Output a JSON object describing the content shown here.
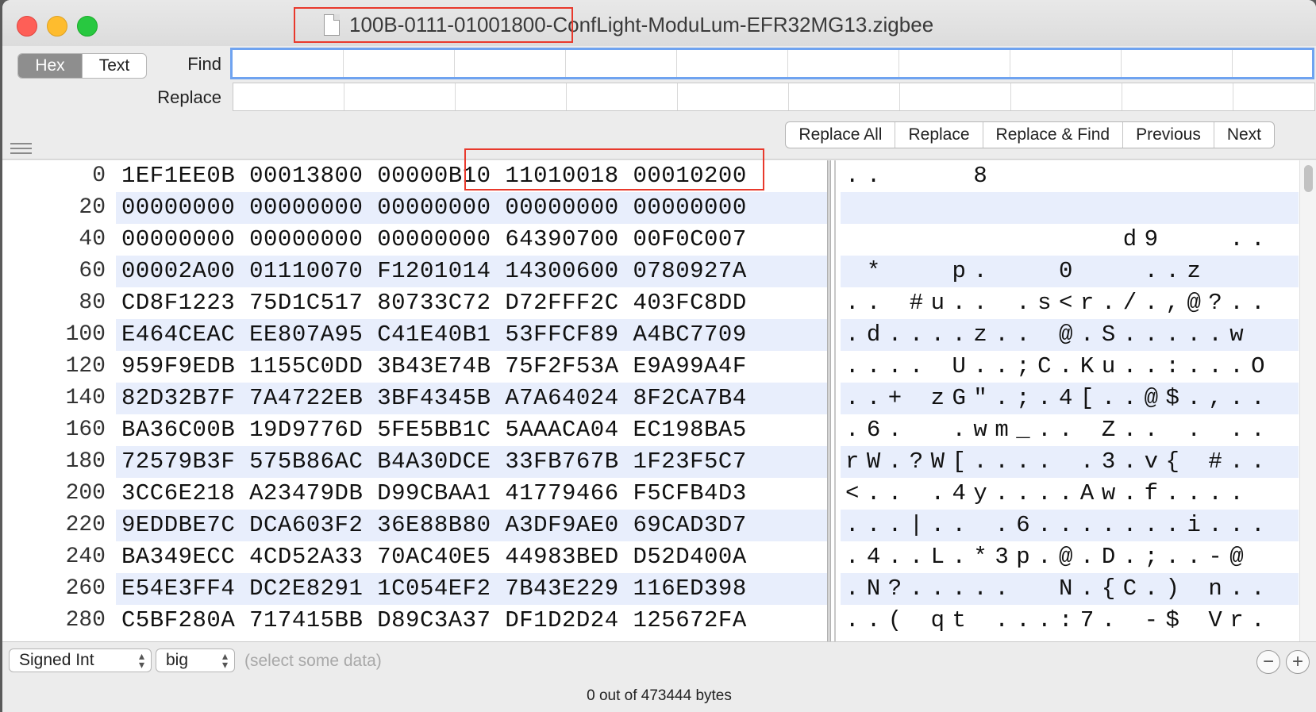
{
  "window": {
    "filename": "100B-0111-01001800-ConfLight-ModuLum-EFR32MG13.zigbee"
  },
  "toolbar": {
    "mode_hex": "Hex",
    "mode_text": "Text",
    "find_label": "Find",
    "replace_label": "Replace",
    "buttons": {
      "replace_all": "Replace All",
      "replace": "Replace",
      "replace_find": "Replace & Find",
      "previous": "Previous",
      "next": "Next"
    }
  },
  "hex_rows": [
    {
      "offset": "0",
      "hex": "1EF1EE0B 00013800 00000B10 11010018 00010200",
      "ascii": "..    8"
    },
    {
      "offset": "20",
      "hex": "00000000 00000000 00000000 00000000 00000000",
      "ascii": ""
    },
    {
      "offset": "40",
      "hex": "00000000 00000000 00000000 64390700 00F0C007",
      "ascii": "             d9   .."
    },
    {
      "offset": "60",
      "hex": "00002A00 01110070 F1201014 14300600 0780927A",
      "ascii": " *   p.   0   ..z"
    },
    {
      "offset": "80",
      "hex": "CD8F1223 75D1C517 80733C72 D72FFF2C 403FC8DD",
      "ascii": ".. #u.. .s<r./.,@?.."
    },
    {
      "offset": "100",
      "hex": "E464CEAC EE807A95 C41E40B1 53FFCF89 A4BC7709",
      "ascii": ".d....z.. @.S.....w"
    },
    {
      "offset": "120",
      "hex": "959F9EDB 1155C0DD 3B43E74B 75F2F53A E9A99A4F",
      "ascii": ".... U..;C.Ku..:...O"
    },
    {
      "offset": "140",
      "hex": "82D32B7F 7A4722EB 3BF4345B A7A64024 8F2CA7B4",
      "ascii": "..+ zG\".;.4[..@$.,.."
    },
    {
      "offset": "160",
      "hex": "BA36C00B 19D9776D 5FE5BB1C 5AAACA04 EC198BA5",
      "ascii": ".6.  .wm_.. Z.. . .."
    },
    {
      "offset": "180",
      "hex": "72579B3F 575B86AC B4A30DCE 33FB767B 1F23F5C7",
      "ascii": "rW.?W[.... .3.v{ #.."
    },
    {
      "offset": "200",
      "hex": "3CC6E218 A23479DB D99CBAA1 41779466 F5CFB4D3",
      "ascii": "<.. .4y....Aw.f...."
    },
    {
      "offset": "220",
      "hex": "9EDDBE7C DCA603F2 36E88B80 A3DF9AE0 69CAD3D7",
      "ascii": "...|.. .6.......i..."
    },
    {
      "offset": "240",
      "hex": "BA349ECC 4CD52A33 70AC40E5 44983BED D52D400A",
      "ascii": ".4..L.*3p.@.D.;..-@"
    },
    {
      "offset": "260",
      "hex": "E54E3FF4 DC2E8291 1C054EF2 7B43E229 116ED398",
      "ascii": ".N?.....  N.{C.) n.."
    },
    {
      "offset": "280",
      "hex": "C5BF280A 717415BB D89C3A37 DF1D2D24 125672FA",
      "ascii": "..( qt ...:7. -$ Vr."
    }
  ],
  "bottom": {
    "type_select": "Signed Int",
    "endian_select": "big",
    "hint": "(select some data)",
    "status": "0 out of 473444 bytes"
  },
  "colors": {
    "highlight": "#e8392c",
    "row_alt": "#e8eefc",
    "focus_ring": "#6fa3f0"
  }
}
